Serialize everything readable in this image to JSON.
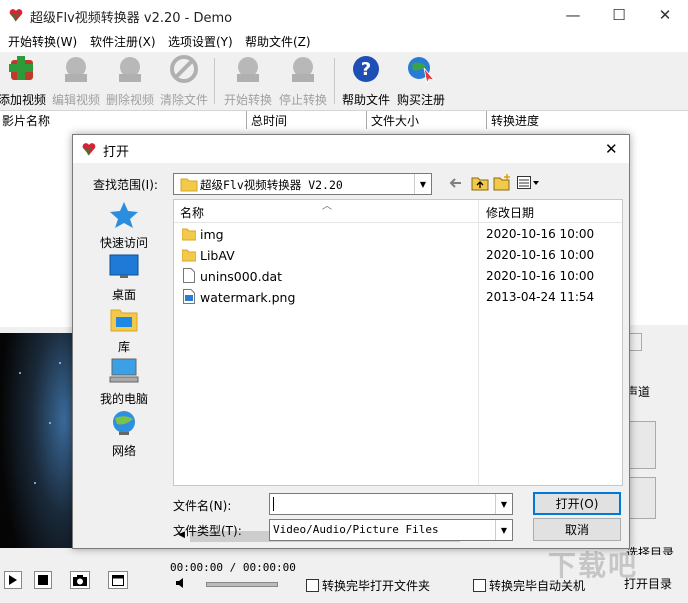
{
  "app": {
    "title": "超级Flv视频转换器 v2.20 - Demo",
    "min": "—",
    "max": "☐",
    "close": "✕"
  },
  "menu": [
    "开始转换(W)",
    "软件注册(X)",
    "选项设置(Y)",
    "帮助文件(Z)"
  ],
  "toolbar": {
    "add": "添加视频",
    "edit": "编辑视频",
    "delete": "删除视频",
    "clear": "清除文件",
    "start": "开始转换",
    "stop": "停止转换",
    "help": "帮助文件",
    "buy": "购买注册"
  },
  "list_columns": [
    "影片名称",
    "总时间",
    "文件大小",
    "转换进度"
  ],
  "right_panel": {
    "channel": "声道",
    "select_dir": "选择目录",
    "open_dir": "打开目录"
  },
  "bottom": {
    "time": "00:00:00 / 00:00:00",
    "open_folder": "转换完毕打开文件夹",
    "auto_shutdown": "转换完毕自动关机"
  },
  "dialog": {
    "title": "打开",
    "close": "✕",
    "look_in_label": "查找范围(I):",
    "look_in_value": "超级Flv视频转换器 V2.20",
    "places": [
      "快速访问",
      "桌面",
      "库",
      "我的电脑",
      "网络"
    ],
    "columns": {
      "name": "名称",
      "date": "修改日期"
    },
    "files": [
      {
        "name": "img",
        "date": "2020-10-16 10:00",
        "type": "folder"
      },
      {
        "name": "LibAV",
        "date": "2020-10-16 10:00",
        "type": "folder"
      },
      {
        "name": "unins000.dat",
        "date": "2020-10-16 10:00",
        "type": "file"
      },
      {
        "name": "watermark.png",
        "date": "2013-04-24 11:54",
        "type": "image"
      }
    ],
    "filename_label": "文件名(N):",
    "filename_value": "",
    "filetype_label": "文件类型(T):",
    "filetype_value": "Video/Audio/Picture Files",
    "open_button": "打开(O)",
    "cancel_button": "取消"
  },
  "watermark": "下载吧"
}
